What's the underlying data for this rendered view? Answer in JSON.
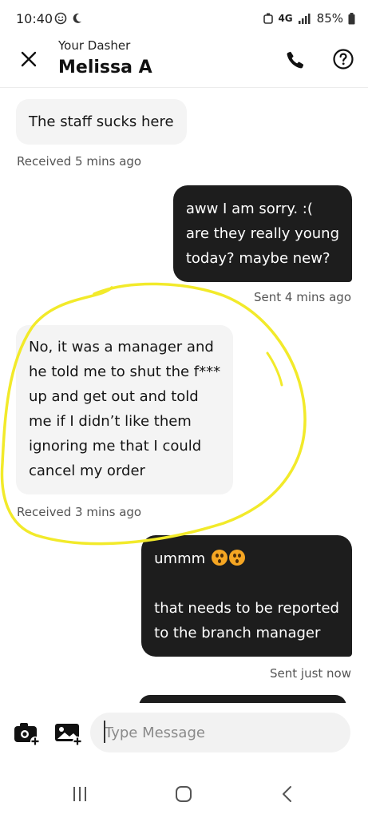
{
  "status_bar": {
    "time": "10:40",
    "network": "4G",
    "battery": "85%"
  },
  "header": {
    "subtitle": "Your Dasher",
    "title": "Melissa A"
  },
  "messages": [
    {
      "direction": "received",
      "lines": [
        "The staff sucks here"
      ],
      "meta": "Received 5 mins ago"
    },
    {
      "direction": "sent",
      "lines": [
        "aww I am sorry. :(",
        "are they really young",
        "today? maybe new?"
      ],
      "meta": "Sent 4 mins ago"
    },
    {
      "direction": "received",
      "lines": [
        "No, it was a manager and",
        "he told me to shut the f***",
        "up and get out and told",
        "me if I didn’t like them",
        "ignoring me that I could",
        "cancel my order"
      ],
      "meta": "Received 3 mins ago"
    },
    {
      "direction": "sent",
      "lines": [
        "ummm",
        "",
        "that needs to be reported",
        "to the branch manager"
      ],
      "meta": "Sent just now"
    }
  ],
  "composer": {
    "placeholder": "Type Message",
    "value": ""
  },
  "colors": {
    "sent_bubble": "#1d1d1d",
    "received_bubble": "#f4f4f4",
    "annotation_circle": "#f2ea2a",
    "emoji": "#f5a623"
  },
  "icons": {
    "close": "close-icon",
    "call": "phone-icon",
    "help": "help-icon",
    "camera": "camera-add-icon",
    "gallery": "image-add-icon",
    "recents": "recent-apps-icon",
    "home": "home-icon",
    "back": "back-icon"
  }
}
